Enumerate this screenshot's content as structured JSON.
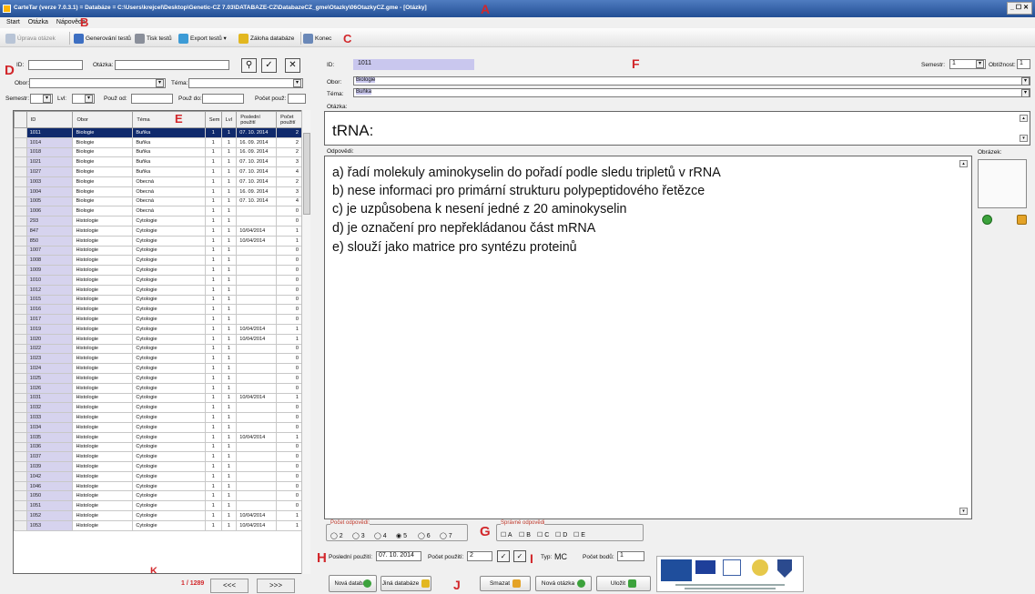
{
  "window": {
    "title": "CarteTar (verze 7.0.3.1) = Databáze = C:\\Users\\krejcel\\Desktop\\Genetic-CZ 7.03\\DATABAZE-CZ\\DatabazeCZ_gme\\Otazky\\06OtazkyCZ.gme - [Otázky]",
    "controls": "_ ☐ ✕"
  },
  "menu": [
    "Start",
    "Otázka",
    "Nápověda"
  ],
  "toolbar": {
    "items": [
      "Úprava otázek",
      "Generování testů",
      "Tisk testů",
      "Export testů ▾",
      "Záloha databáze",
      "Konec"
    ]
  },
  "markers": {
    "a": "A",
    "b": "B",
    "c": "C",
    "d": "D",
    "e": "E",
    "f": "F",
    "g": "G",
    "h": "H",
    "i": "I",
    "j": "J",
    "k": "K"
  },
  "filter": {
    "id_label": "ID:",
    "question_label": "Otázka:",
    "field_label": "Obor:",
    "topic_label": "Téma:",
    "semester_label": "Semestr:",
    "year_label": "Lvl:",
    "used_from_label": "Použ od:",
    "used_to_label": "Použ do:",
    "usage_count_label": "Počet použ:"
  },
  "colors": {
    "selected_row": "#102a6c",
    "id_cell": "#d6d3ee",
    "marker": "#d2272b",
    "id_field": "#c9c7ee"
  },
  "grid": {
    "headers": [
      "ID",
      "Obor",
      "Téma",
      "Sem",
      "Lvl",
      "Poslední použití",
      "Počet použití"
    ],
    "rows": [
      [
        "1011",
        "Biologie",
        "Buňka",
        "1",
        "1",
        "07. 10. 2014",
        "2"
      ],
      [
        "1014",
        "Biologie",
        "Buňka",
        "1",
        "1",
        "16. 09. 2014",
        "2"
      ],
      [
        "1018",
        "Biologie",
        "Buňka",
        "1",
        "1",
        "16. 09. 2014",
        "2"
      ],
      [
        "1021",
        "Biologie",
        "Buňka",
        "1",
        "1",
        "07. 10. 2014",
        "3"
      ],
      [
        "1027",
        "Biologie",
        "Buňka",
        "1",
        "1",
        "07. 10. 2014",
        "4"
      ],
      [
        "1003",
        "Biologie",
        "Obecná",
        "1",
        "1",
        "07. 10. 2014",
        "2"
      ],
      [
        "1004",
        "Biologie",
        "Obecná",
        "1",
        "1",
        "16. 09. 2014",
        "3"
      ],
      [
        "1005",
        "Biologie",
        "Obecná",
        "1",
        "1",
        "07. 10. 2014",
        "4"
      ],
      [
        "1006",
        "Biologie",
        "Obecná",
        "1",
        "1",
        "",
        "0"
      ],
      [
        "293",
        "Histologie",
        "Cytologie",
        "1",
        "1",
        "",
        "0"
      ],
      [
        "847",
        "Histologie",
        "Cytologie",
        "1",
        "1",
        "10/04/2014",
        "1"
      ],
      [
        "850",
        "Histologie",
        "Cytologie",
        "1",
        "1",
        "10/04/2014",
        "1"
      ],
      [
        "1007",
        "Histologie",
        "Cytologie",
        "1",
        "1",
        "",
        "0"
      ],
      [
        "1008",
        "Histologie",
        "Cytologie",
        "1",
        "1",
        "",
        "0"
      ],
      [
        "1009",
        "Histologie",
        "Cytologie",
        "1",
        "1",
        "",
        "0"
      ],
      [
        "1010",
        "Histologie",
        "Cytologie",
        "1",
        "1",
        "",
        "0"
      ],
      [
        "1012",
        "Histologie",
        "Cytologie",
        "1",
        "1",
        "",
        "0"
      ],
      [
        "1015",
        "Histologie",
        "Cytologie",
        "1",
        "1",
        "",
        "0"
      ],
      [
        "1016",
        "Histologie",
        "Cytologie",
        "1",
        "1",
        "",
        "0"
      ],
      [
        "1017",
        "Histologie",
        "Cytologie",
        "1",
        "1",
        "",
        "0"
      ],
      [
        "1019",
        "Histologie",
        "Cytologie",
        "1",
        "1",
        "10/04/2014",
        "1"
      ],
      [
        "1020",
        "Histologie",
        "Cytologie",
        "1",
        "1",
        "10/04/2014",
        "1"
      ],
      [
        "1022",
        "Histologie",
        "Cytologie",
        "1",
        "1",
        "",
        "0"
      ],
      [
        "1023",
        "Histologie",
        "Cytologie",
        "1",
        "1",
        "",
        "0"
      ],
      [
        "1024",
        "Histologie",
        "Cytologie",
        "1",
        "1",
        "",
        "0"
      ],
      [
        "1025",
        "Histologie",
        "Cytologie",
        "1",
        "1",
        "",
        "0"
      ],
      [
        "1026",
        "Histologie",
        "Cytologie",
        "1",
        "1",
        "",
        "0"
      ],
      [
        "1031",
        "Histologie",
        "Cytologie",
        "1",
        "1",
        "10/04/2014",
        "1"
      ],
      [
        "1032",
        "Histologie",
        "Cytologie",
        "1",
        "1",
        "",
        "0"
      ],
      [
        "1033",
        "Histologie",
        "Cytologie",
        "1",
        "1",
        "",
        "0"
      ],
      [
        "1034",
        "Histologie",
        "Cytologie",
        "1",
        "1",
        "",
        "0"
      ],
      [
        "1035",
        "Histologie",
        "Cytologie",
        "1",
        "1",
        "10/04/2014",
        "1"
      ],
      [
        "1036",
        "Histologie",
        "Cytologie",
        "1",
        "1",
        "",
        "0"
      ],
      [
        "1037",
        "Histologie",
        "Cytologie",
        "1",
        "1",
        "",
        "0"
      ],
      [
        "1039",
        "Histologie",
        "Cytologie",
        "1",
        "1",
        "",
        "0"
      ],
      [
        "1042",
        "Histologie",
        "Cytologie",
        "1",
        "1",
        "",
        "0"
      ],
      [
        "1046",
        "Histologie",
        "Cytologie",
        "1",
        "1",
        "",
        "0"
      ],
      [
        "1050",
        "Histologie",
        "Cytologie",
        "1",
        "1",
        "",
        "0"
      ],
      [
        "1051",
        "Histologie",
        "Cytologie",
        "1",
        "1",
        "",
        "0"
      ],
      [
        "1052",
        "Histologie",
        "Cytologie",
        "1",
        "1",
        "10/04/2014",
        "1"
      ],
      [
        "1053",
        "Histologie",
        "Cytologie",
        "1",
        "1",
        "10/04/2014",
        "1"
      ]
    ]
  },
  "pager": {
    "position": "1 / 1289",
    "prev": "<<<",
    "next": ">>>"
  },
  "detail": {
    "id_label": "ID:",
    "id_value": "1011",
    "semester_label": "Semestr:",
    "semester_value": "1",
    "difficulty_label": "Obtížnost:",
    "difficulty_value": "1",
    "field_label": "Obor:",
    "field_value": "Biologie",
    "topic_label": "Téma:",
    "topic_value": "Buňka",
    "question_label": "Otázka:",
    "question_text": "tRNA:",
    "answers_label": "Odpovědi:",
    "answers": [
      "a) řadí molekuly aminokyselin do pořadí podle sledu tripletů v rRNA",
      "b) nese informaci pro primární strukturu polypeptidového řetězce",
      "c) je uzpůsobena k nesení jedné z 20 aminokyselin",
      "d) je označení pro nepřekládanou část mRNA",
      "e) slouží jako matrice pro syntézu proteinů"
    ],
    "image_label": "Obrázek:",
    "answer_count_label": "Počet odpovědí:",
    "answer_count_options": [
      "2",
      "3",
      "4",
      "5",
      "6",
      "7"
    ],
    "answer_count_selected": "5",
    "correct_label": "Správné odpovědi",
    "correct_options": [
      "A",
      "B",
      "C",
      "D",
      "E"
    ],
    "last_used_label": "Poslední použití:",
    "last_used_value": "07. 10. 2014",
    "usage_count_label": "Počet použití:",
    "usage_count_value": "2",
    "type_label": "Typ:",
    "type_value": "MC",
    "points_label": "Počet bodů:",
    "points_value": "1"
  },
  "buttons": {
    "new_db": "Nová databáze",
    "other_db": "Jiná databáze",
    "delete": "Smazat",
    "new_question": "Nová otázka",
    "save": "Uložit"
  }
}
